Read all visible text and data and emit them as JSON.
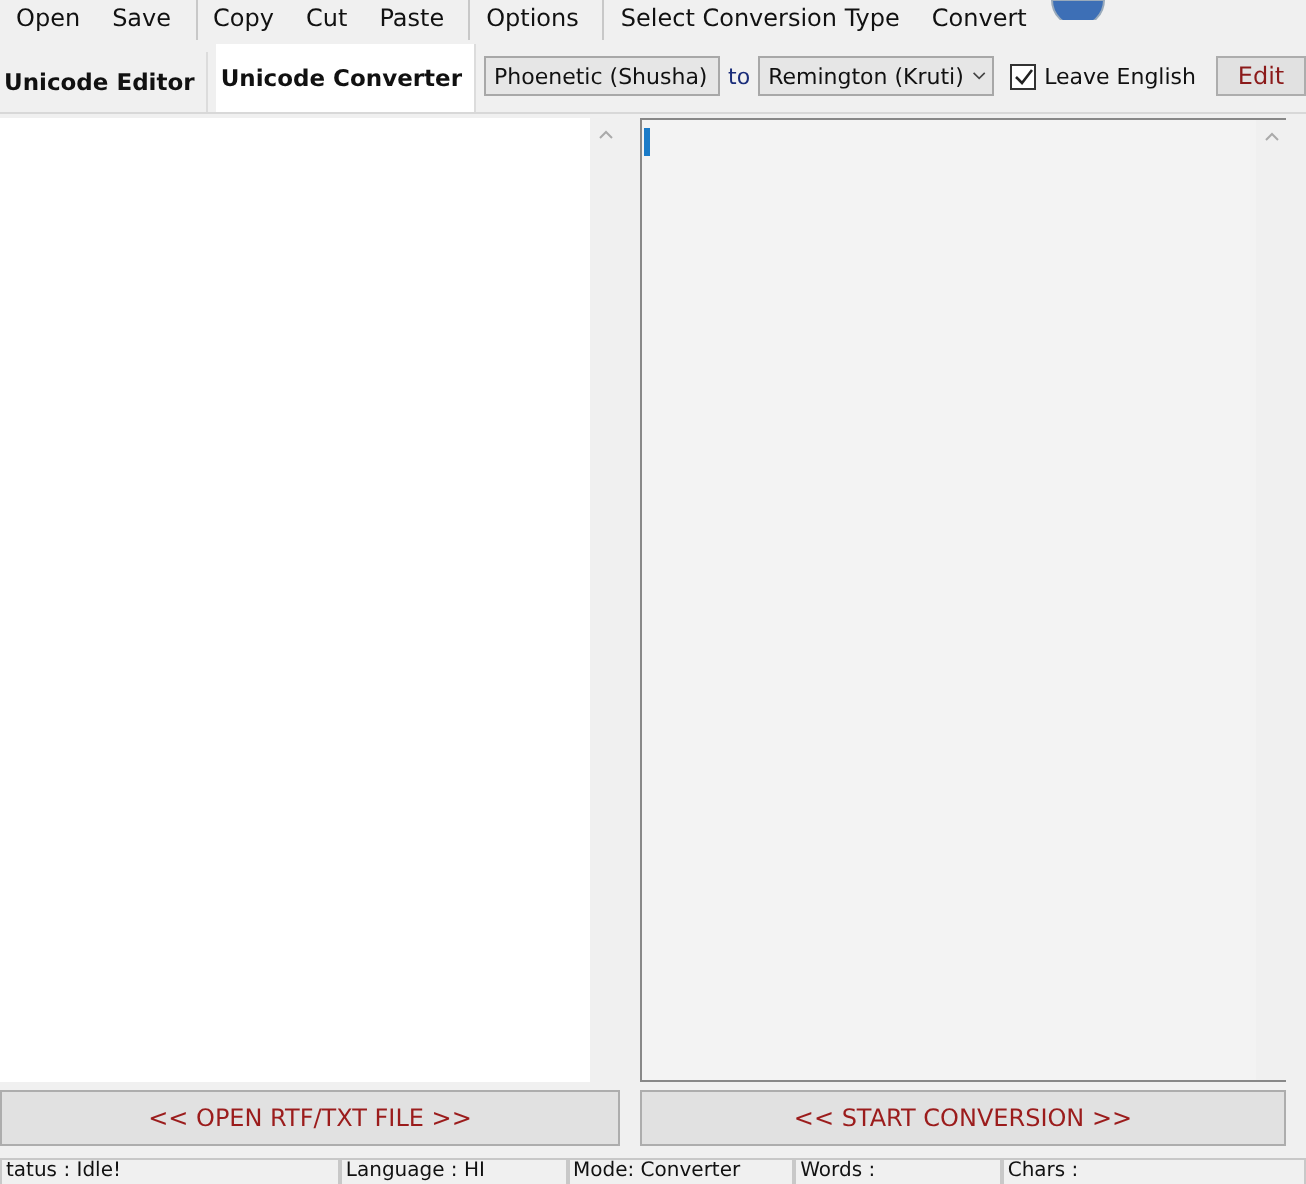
{
  "toolbar": [
    {
      "label": "Open"
    },
    {
      "label": "Save"
    },
    {
      "label": "Copy",
      "group_start": true
    },
    {
      "label": "Cut"
    },
    {
      "label": "Paste"
    },
    {
      "label": "Options",
      "group_start": true
    },
    {
      "label": "Select Conversion Type",
      "group_start": true
    },
    {
      "label": "Convert"
    }
  ],
  "tabs": [
    {
      "label": "Unicode Editor",
      "selected": false
    },
    {
      "label": "Unicode Converter",
      "selected": true
    }
  ],
  "source_select": {
    "value": "Phoenetic (Shusha)"
  },
  "to_label": "to",
  "target_select": {
    "value": "Remington (Kruti)"
  },
  "leave_english": {
    "label": "Leave English",
    "checked": true
  },
  "edit_button": "Edit",
  "open_button": "<< OPEN RTF/TXT FILE >>",
  "start_button": "<< START CONVERSION >>",
  "status_bar": [
    "tatus : Idle!",
    "Language : HI",
    "Mode: Converter",
    "Words :",
    "Chars :"
  ]
}
